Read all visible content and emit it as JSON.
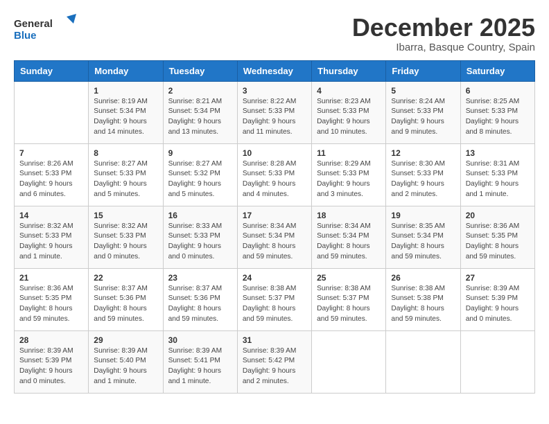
{
  "logo": {
    "line1": "General",
    "line2": "Blue"
  },
  "title": "December 2025",
  "location": "Ibarra, Basque Country, Spain",
  "days_of_week": [
    "Sunday",
    "Monday",
    "Tuesday",
    "Wednesday",
    "Thursday",
    "Friday",
    "Saturday"
  ],
  "weeks": [
    [
      {
        "day": "",
        "content": ""
      },
      {
        "day": "1",
        "content": "Sunrise: 8:19 AM\nSunset: 5:34 PM\nDaylight: 9 hours\nand 14 minutes."
      },
      {
        "day": "2",
        "content": "Sunrise: 8:21 AM\nSunset: 5:34 PM\nDaylight: 9 hours\nand 13 minutes."
      },
      {
        "day": "3",
        "content": "Sunrise: 8:22 AM\nSunset: 5:33 PM\nDaylight: 9 hours\nand 11 minutes."
      },
      {
        "day": "4",
        "content": "Sunrise: 8:23 AM\nSunset: 5:33 PM\nDaylight: 9 hours\nand 10 minutes."
      },
      {
        "day": "5",
        "content": "Sunrise: 8:24 AM\nSunset: 5:33 PM\nDaylight: 9 hours\nand 9 minutes."
      },
      {
        "day": "6",
        "content": "Sunrise: 8:25 AM\nSunset: 5:33 PM\nDaylight: 9 hours\nand 8 minutes."
      }
    ],
    [
      {
        "day": "7",
        "content": "Sunrise: 8:26 AM\nSunset: 5:33 PM\nDaylight: 9 hours\nand 6 minutes."
      },
      {
        "day": "8",
        "content": "Sunrise: 8:27 AM\nSunset: 5:33 PM\nDaylight: 9 hours\nand 5 minutes."
      },
      {
        "day": "9",
        "content": "Sunrise: 8:27 AM\nSunset: 5:32 PM\nDaylight: 9 hours\nand 5 minutes."
      },
      {
        "day": "10",
        "content": "Sunrise: 8:28 AM\nSunset: 5:33 PM\nDaylight: 9 hours\nand 4 minutes."
      },
      {
        "day": "11",
        "content": "Sunrise: 8:29 AM\nSunset: 5:33 PM\nDaylight: 9 hours\nand 3 minutes."
      },
      {
        "day": "12",
        "content": "Sunrise: 8:30 AM\nSunset: 5:33 PM\nDaylight: 9 hours\nand 2 minutes."
      },
      {
        "day": "13",
        "content": "Sunrise: 8:31 AM\nSunset: 5:33 PM\nDaylight: 9 hours\nand 1 minute."
      }
    ],
    [
      {
        "day": "14",
        "content": "Sunrise: 8:32 AM\nSunset: 5:33 PM\nDaylight: 9 hours\nand 1 minute."
      },
      {
        "day": "15",
        "content": "Sunrise: 8:32 AM\nSunset: 5:33 PM\nDaylight: 9 hours\nand 0 minutes."
      },
      {
        "day": "16",
        "content": "Sunrise: 8:33 AM\nSunset: 5:33 PM\nDaylight: 9 hours\nand 0 minutes."
      },
      {
        "day": "17",
        "content": "Sunrise: 8:34 AM\nSunset: 5:34 PM\nDaylight: 8 hours\nand 59 minutes."
      },
      {
        "day": "18",
        "content": "Sunrise: 8:34 AM\nSunset: 5:34 PM\nDaylight: 8 hours\nand 59 minutes."
      },
      {
        "day": "19",
        "content": "Sunrise: 8:35 AM\nSunset: 5:34 PM\nDaylight: 8 hours\nand 59 minutes."
      },
      {
        "day": "20",
        "content": "Sunrise: 8:36 AM\nSunset: 5:35 PM\nDaylight: 8 hours\nand 59 minutes."
      }
    ],
    [
      {
        "day": "21",
        "content": "Sunrise: 8:36 AM\nSunset: 5:35 PM\nDaylight: 8 hours\nand 59 minutes."
      },
      {
        "day": "22",
        "content": "Sunrise: 8:37 AM\nSunset: 5:36 PM\nDaylight: 8 hours\nand 59 minutes."
      },
      {
        "day": "23",
        "content": "Sunrise: 8:37 AM\nSunset: 5:36 PM\nDaylight: 8 hours\nand 59 minutes."
      },
      {
        "day": "24",
        "content": "Sunrise: 8:38 AM\nSunset: 5:37 PM\nDaylight: 8 hours\nand 59 minutes."
      },
      {
        "day": "25",
        "content": "Sunrise: 8:38 AM\nSunset: 5:37 PM\nDaylight: 8 hours\nand 59 minutes."
      },
      {
        "day": "26",
        "content": "Sunrise: 8:38 AM\nSunset: 5:38 PM\nDaylight: 8 hours\nand 59 minutes."
      },
      {
        "day": "27",
        "content": "Sunrise: 8:39 AM\nSunset: 5:39 PM\nDaylight: 9 hours\nand 0 minutes."
      }
    ],
    [
      {
        "day": "28",
        "content": "Sunrise: 8:39 AM\nSunset: 5:39 PM\nDaylight: 9 hours\nand 0 minutes."
      },
      {
        "day": "29",
        "content": "Sunrise: 8:39 AM\nSunset: 5:40 PM\nDaylight: 9 hours\nand 1 minute."
      },
      {
        "day": "30",
        "content": "Sunrise: 8:39 AM\nSunset: 5:41 PM\nDaylight: 9 hours\nand 1 minute."
      },
      {
        "day": "31",
        "content": "Sunrise: 8:39 AM\nSunset: 5:42 PM\nDaylight: 9 hours\nand 2 minutes."
      },
      {
        "day": "",
        "content": ""
      },
      {
        "day": "",
        "content": ""
      },
      {
        "day": "",
        "content": ""
      }
    ]
  ]
}
